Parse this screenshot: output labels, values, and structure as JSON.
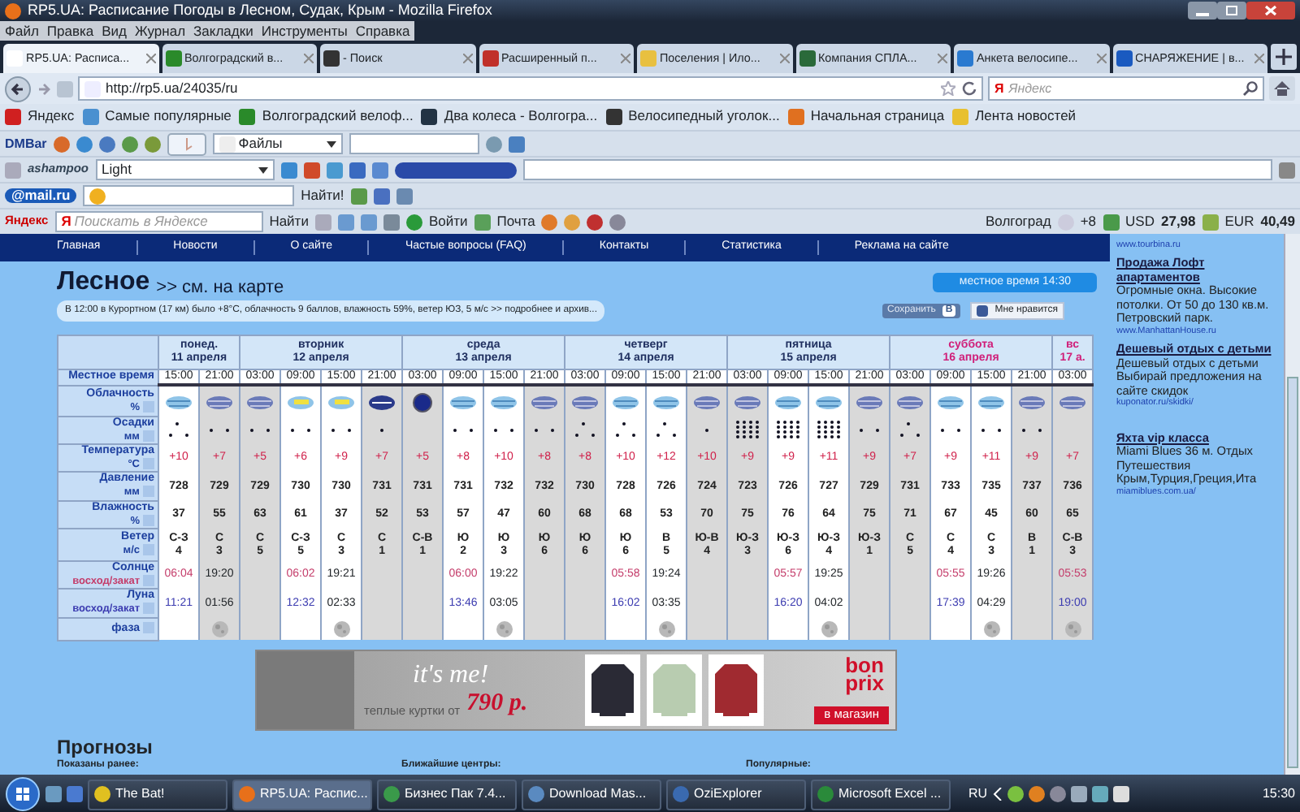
{
  "window": {
    "title": "RP5.UA: Расписание Погоды в Лесном, Судак, Крым - Mozilla Firefox"
  },
  "menu": [
    "Файл",
    "Правка",
    "Вид",
    "Журнал",
    "Закладки",
    "Инструменты",
    "Справка"
  ],
  "tabs": [
    {
      "label": "RP5.UA: Расписа...",
      "selected": true
    },
    {
      "label": "Волгоградский в...",
      "selected": false
    },
    {
      "label": "- Поиск",
      "selected": false
    },
    {
      "label": "Расширенный п...",
      "selected": false
    },
    {
      "label": "Поселения | Ило...",
      "selected": false
    },
    {
      "label": "Компания СПЛА...",
      "selected": false
    },
    {
      "label": "Анкета велосипе...",
      "selected": false
    },
    {
      "label": "СНАРЯЖЕНИЕ | в...",
      "selected": false
    }
  ],
  "nav": {
    "url": "http://rp5.ua/24035/ru",
    "search_mark": "Я",
    "search_placeholder": "Яндекс"
  },
  "bookmarks": [
    "Яндекс",
    "Самые популярные",
    "Волгоградский велоф...",
    "Два колеса - Волгогра...",
    "Велосипедный уголок...",
    "Начальная страница",
    "Лента новостей"
  ],
  "dmbar": {
    "logo": "DMBar",
    "dropdown": "Файлы"
  },
  "ashampoo": {
    "logo": "ashampoo",
    "dropdown": "Light"
  },
  "mailru": {
    "logo": "@mail.ru",
    "button": "Найти!"
  },
  "yandex_bar": {
    "logo": "Яндекс",
    "mark": "Я",
    "placeholder": "Поискать в Яндексе",
    "search_button": "Найти",
    "login": "Войти",
    "mail": "Почта",
    "city": "Волгоград",
    "temperature": "+8",
    "rates": [
      {
        "currency": "USD",
        "value": "27,98"
      },
      {
        "currency": "EUR",
        "value": "40,49"
      }
    ]
  },
  "site_nav": [
    "Главная",
    "Новости",
    "О сайте",
    "Частые вопросы (FAQ)",
    "Контакты",
    "Статистика",
    "Реклама на сайте"
  ],
  "location": {
    "title": "Лесное",
    "map_link": ">> см. на карте",
    "local_time": "местное время  14:30"
  },
  "observation": {
    "text": "В 12:00 в Курортном (17 км) было +8°С, облачность 9 баллов, влажность 59%, ветер ЮЗ, 5 м/с",
    "link": ">> подробнее и архив..."
  },
  "social": {
    "save": "Сохранить",
    "vk": "В",
    "like": "Мне нравится"
  },
  "forecast": {
    "row_labels": [
      {
        "label": "Местное время"
      },
      {
        "label": "Облачность",
        "unit": "%"
      },
      {
        "label": "Осадки",
        "unit": "мм"
      },
      {
        "label": "Температура",
        "unit": "°C"
      },
      {
        "label": "Давление",
        "unit": "мм"
      },
      {
        "label": "Влажность",
        "unit": "%"
      },
      {
        "label": "Ветер",
        "unit": "м/с"
      },
      {
        "label": "Солнце",
        "unit": "восход/закат"
      },
      {
        "label": "Луна",
        "unit": "восход/закат"
      },
      {
        "label": "фаза"
      }
    ],
    "days": [
      {
        "weekday": "понед.",
        "date": "11 апреля",
        "weekend": false,
        "slots": [
          {
            "time": "15:00",
            "night": false,
            "clouds": {
              "kind": "cloudy"
            },
            "precip": {
              "kind": "pair-top"
            },
            "temp": "+10",
            "pressure": "728",
            "humidity": "37",
            "wind_dir": "С-З",
            "wind_speed": "4",
            "sunrise": "06:04",
            "moonrise": "11:21"
          },
          {
            "time": "21:00",
            "night": true,
            "clouds": {
              "kind": "overcast"
            },
            "precip": {
              "kind": "pair"
            },
            "temp": "+7",
            "pressure": "729",
            "humidity": "55",
            "wind_dir": "С",
            "wind_speed": "3",
            "sunset": "19:20",
            "moonset": "01:56",
            "moon_phase": true
          }
        ]
      },
      {
        "weekday": "вторник",
        "date": "12 апреля",
        "weekend": false,
        "slots": [
          {
            "time": "03:00",
            "night": true,
            "clouds": {
              "kind": "overcast"
            },
            "precip": {
              "kind": "pair"
            },
            "temp": "+5",
            "pressure": "729",
            "humidity": "63",
            "wind_dir": "С",
            "wind_speed": "5"
          },
          {
            "time": "09:00",
            "night": false,
            "clouds": {
              "kind": "sunny-cloudy"
            },
            "precip": {
              "kind": "pair"
            },
            "temp": "+6",
            "pressure": "730",
            "humidity": "61",
            "wind_dir": "С-З",
            "wind_speed": "5",
            "sunrise": "06:02",
            "moonrise": "12:32"
          },
          {
            "time": "15:00",
            "night": false,
            "clouds": {
              "kind": "sunny-cloudy"
            },
            "precip": {
              "kind": "pair"
            },
            "temp": "+9",
            "pressure": "730",
            "humidity": "37",
            "wind_dir": "С",
            "wind_speed": "3",
            "sunset": "19:21",
            "moonset": "02:33",
            "moon_phase": true
          },
          {
            "time": "21:00",
            "night": true,
            "clouds": {
              "kind": "night-overcast"
            },
            "precip": {
              "kind": "single"
            },
            "temp": "+7",
            "pressure": "731",
            "humidity": "52",
            "wind_dir": "С",
            "wind_speed": "1"
          }
        ]
      },
      {
        "weekday": "среда",
        "date": "13 апреля",
        "weekend": false,
        "slots": [
          {
            "time": "03:00",
            "night": true,
            "clouds": {
              "kind": "night-clear"
            },
            "temp": "+5",
            "pressure": "731",
            "humidity": "53",
            "wind_dir": "С-В",
            "wind_speed": "1"
          },
          {
            "time": "09:00",
            "night": false,
            "clouds": {
              "kind": "cloudy"
            },
            "precip": {
              "kind": "pair"
            },
            "temp": "+8",
            "pressure": "731",
            "humidity": "57",
            "wind_dir": "Ю",
            "wind_speed": "2",
            "sunrise": "06:00",
            "moonrise": "13:46"
          },
          {
            "time": "15:00",
            "night": false,
            "clouds": {
              "kind": "cloudy"
            },
            "precip": {
              "kind": "pair"
            },
            "temp": "+10",
            "pressure": "732",
            "humidity": "47",
            "wind_dir": "Ю",
            "wind_speed": "3",
            "sunset": "19:22",
            "moonset": "03:05",
            "moon_phase": true
          },
          {
            "time": "21:00",
            "night": true,
            "clouds": {
              "kind": "overcast"
            },
            "precip": {
              "kind": "pair"
            },
            "temp": "+8",
            "pressure": "732",
            "humidity": "60",
            "wind_dir": "Ю",
            "wind_speed": "6"
          }
        ]
      },
      {
        "weekday": "четверг",
        "date": "14 апреля",
        "weekend": false,
        "slots": [
          {
            "time": "03:00",
            "night": true,
            "clouds": {
              "kind": "overcast"
            },
            "precip": {
              "kind": "pair-top"
            },
            "temp": "+8",
            "pressure": "730",
            "humidity": "68",
            "wind_dir": "Ю",
            "wind_speed": "6"
          },
          {
            "time": "09:00",
            "night": false,
            "clouds": {
              "kind": "cloudy"
            },
            "precip": {
              "kind": "pair-top"
            },
            "temp": "+10",
            "pressure": "728",
            "humidity": "68",
            "wind_dir": "Ю",
            "wind_speed": "6",
            "sunrise": "05:58",
            "moonrise": "16:02"
          },
          {
            "time": "15:00",
            "night": false,
            "clouds": {
              "kind": "cloudy"
            },
            "precip": {
              "kind": "pair-top"
            },
            "temp": "+12",
            "pressure": "726",
            "humidity": "53",
            "wind_dir": "В",
            "wind_speed": "5",
            "sunset": "19:24",
            "moonset": "03:35",
            "moon_phase": true
          },
          {
            "time": "21:00",
            "night": true,
            "clouds": {
              "kind": "overcast"
            },
            "precip": {
              "kind": "single"
            },
            "temp": "+10",
            "pressure": "724",
            "humidity": "70",
            "wind_dir": "Ю-В",
            "wind_speed": "4"
          }
        ]
      },
      {
        "weekday": "пятница",
        "date": "15 апреля",
        "weekend": false,
        "slots": [
          {
            "time": "03:00",
            "night": true,
            "clouds": {
              "kind": "overcast"
            },
            "precip": {
              "kind": "rain"
            },
            "temp": "+9",
            "pressure": "723",
            "humidity": "75",
            "wind_dir": "Ю-З",
            "wind_speed": "3"
          },
          {
            "time": "09:00",
            "night": false,
            "clouds": {
              "kind": "cloudy"
            },
            "precip": {
              "kind": "rain"
            },
            "temp": "+9",
            "pressure": "726",
            "humidity": "76",
            "wind_dir": "Ю-З",
            "wind_speed": "6",
            "sunrise": "05:57",
            "moonrise": "16:20"
          },
          {
            "time": "15:00",
            "night": false,
            "clouds": {
              "kind": "cloudy"
            },
            "precip": {
              "kind": "rain"
            },
            "temp": "+11",
            "pressure": "727",
            "humidity": "64",
            "wind_dir": "Ю-З",
            "wind_speed": "4",
            "sunset": "19:25",
            "moonset": "04:02",
            "moon_phase": true
          },
          {
            "time": "21:00",
            "night": true,
            "clouds": {
              "kind": "overcast"
            },
            "precip": {
              "kind": "pair"
            },
            "temp": "+9",
            "pressure": "729",
            "humidity": "75",
            "wind_dir": "Ю-З",
            "wind_speed": "1"
          }
        ]
      },
      {
        "weekday": "суббота",
        "date": "16 апреля",
        "weekend": true,
        "slots": [
          {
            "time": "03:00",
            "night": true,
            "clouds": {
              "kind": "overcast"
            },
            "precip": {
              "kind": "pair-top"
            },
            "temp": "+7",
            "pressure": "731",
            "humidity": "71",
            "wind_dir": "С",
            "wind_speed": "5"
          },
          {
            "time": "09:00",
            "night": false,
            "clouds": {
              "kind": "cloudy"
            },
            "precip": {
              "kind": "pair"
            },
            "temp": "+9",
            "pressure": "733",
            "humidity": "67",
            "wind_dir": "С",
            "wind_speed": "4",
            "sunrise": "05:55",
            "moonrise": "17:39"
          },
          {
            "time": "15:00",
            "night": false,
            "clouds": {
              "kind": "cloudy"
            },
            "precip": {
              "kind": "pair"
            },
            "temp": "+11",
            "pressure": "735",
            "humidity": "45",
            "wind_dir": "С",
            "wind_speed": "3",
            "sunset": "19:26",
            "moonset": "04:29",
            "moon_phase": true
          },
          {
            "time": "21:00",
            "night": true,
            "clouds": {
              "kind": "overcast"
            },
            "precip": {
              "kind": "pair"
            },
            "temp": "+9",
            "pressure": "737",
            "humidity": "60",
            "wind_dir": "В",
            "wind_speed": "1"
          }
        ]
      },
      {
        "weekday": "вс",
        "date": "17 а.",
        "weekend": true,
        "slots": [
          {
            "time": "03:00",
            "night": true,
            "clouds": {
              "kind": "overcast"
            },
            "temp": "+7",
            "pressure": "736",
            "humidity": "65",
            "wind_dir": "С-В",
            "wind_speed": "3",
            "sunrise": "05:53",
            "moonrise": "19:00",
            "moon_phase": true
          }
        ]
      }
    ]
  },
  "banner": {
    "slogan": "it's me!",
    "caption": "теплые куртки от",
    "price": "790 р.",
    "logo": "bon prix",
    "button": "в магазин"
  },
  "forecasts_section": {
    "title": "Прогнозы",
    "columns": [
      "Показаны ранее:",
      "Ближайшие центры:",
      "Популярные:"
    ]
  },
  "sidebar_ads": [
    {
      "url": "www.tourbina.ru"
    },
    {
      "title": "Продажа Лофт апартаментов",
      "text": "Огромные окна. Высокие потолки. От 50 до 130 кв.м. Петровский парк.",
      "url": "www.ManhattanHouse.ru"
    },
    {
      "title": "Дешевый отдых с детьми",
      "text": "Дешевый отдых с детьми Выбирай предложения на сайте скидок",
      "url": "kuponator.ru/skidki/"
    },
    {
      "title": "Яхта vip класса",
      "text": "Miami Blues 36 м. Отдых Путешествия Крым,Турция,Греция,Ита",
      "url": "miamiblues.com.ua/"
    }
  ],
  "taskbar": {
    "tasks": [
      {
        "label": "The Bat!",
        "selected": false
      },
      {
        "label": "RP5.UA: Распис...",
        "selected": true
      },
      {
        "label": "Бизнес Пак 7.4...",
        "selected": false
      },
      {
        "label": "Download Mas...",
        "selected": false
      },
      {
        "label": "OziExplorer",
        "selected": false
      },
      {
        "label": "Microsoft Excel ...",
        "selected": false
      }
    ],
    "language": "RU",
    "clock": "15:30"
  }
}
